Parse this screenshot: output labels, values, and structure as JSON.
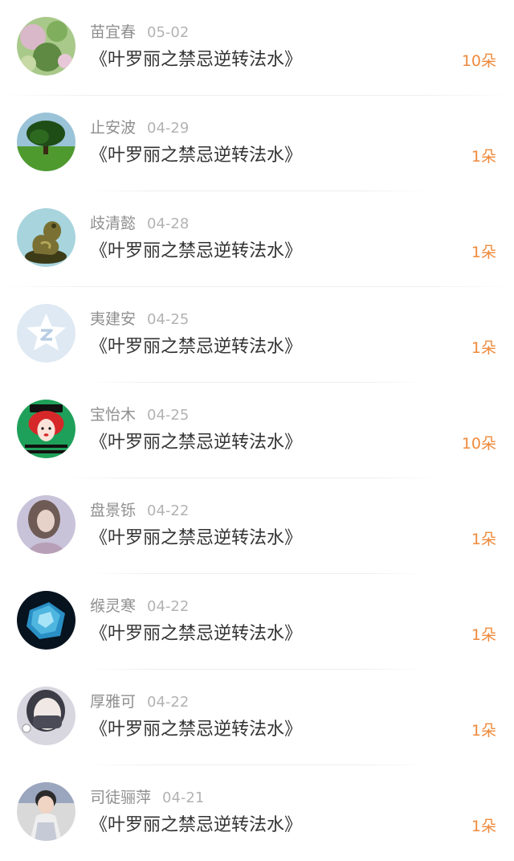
{
  "records": [
    {
      "user": "苗宜春",
      "date": "05-02",
      "title": "《叶罗丽之禁忌逆转法水》",
      "amount": "10朵",
      "avatar_icon": "flower-photo-icon",
      "colors": [
        "#9bc27a",
        "#d9b8c9",
        "#5f8a43"
      ]
    },
    {
      "user": "止安波",
      "date": "04-29",
      "title": "《叶罗丽之禁忌逆转法水》",
      "amount": "1朵",
      "avatar_icon": "tree-landscape-icon",
      "colors": [
        "#3f8f2f",
        "#9ac3d8",
        "#1f4d16"
      ]
    },
    {
      "user": "歧清懿",
      "date": "04-28",
      "title": "《叶罗丽之禁忌逆转法水》",
      "amount": "1朵",
      "avatar_icon": "dragon-statue-icon",
      "colors": [
        "#a7d4dd",
        "#7a7033",
        "#3d3a18"
      ]
    },
    {
      "user": "夷建安",
      "date": "04-25",
      "title": "《叶罗丽之禁忌逆转法水》",
      "amount": "1朵",
      "avatar_icon": "qzone-star-icon",
      "colors": [
        "#dfe9f3",
        "#ffffff",
        "#b8cde3"
      ]
    },
    {
      "user": "宝怡木",
      "date": "04-25",
      "title": "《叶罗丽之禁忌逆转法水》",
      "amount": "10朵",
      "avatar_icon": "cartoon-girl-icon",
      "colors": [
        "#1fa05a",
        "#d62828",
        "#111111"
      ]
    },
    {
      "user": "盘景铄",
      "date": "04-22",
      "title": "《叶罗丽之禁忌逆转法水》",
      "amount": "1朵",
      "avatar_icon": "portrait-photo-icon",
      "colors": [
        "#c9c3da",
        "#e6d2c8",
        "#6e5b55"
      ]
    },
    {
      "user": "缑灵寒",
      "date": "04-22",
      "title": "《叶罗丽之禁忌逆转法水》",
      "amount": "1朵",
      "avatar_icon": "ice-cube-icon",
      "colors": [
        "#07131f",
        "#4fb6e0",
        "#a8e4f7"
      ]
    },
    {
      "user": "厚雅可",
      "date": "04-22",
      "title": "《叶罗丽之禁忌逆转法水》",
      "amount": "1朵",
      "avatar_icon": "masked-person-icon",
      "colors": [
        "#d8d6df",
        "#4a4b57",
        "#efe8e4"
      ]
    },
    {
      "user": "司徒骊萍",
      "date": "04-21",
      "title": "《叶罗丽之禁忌逆转法水》",
      "amount": "1朵",
      "avatar_icon": "child-photo-icon",
      "colors": [
        "#d9d9d9",
        "#2b2b2b",
        "#9aa6bd"
      ]
    }
  ]
}
